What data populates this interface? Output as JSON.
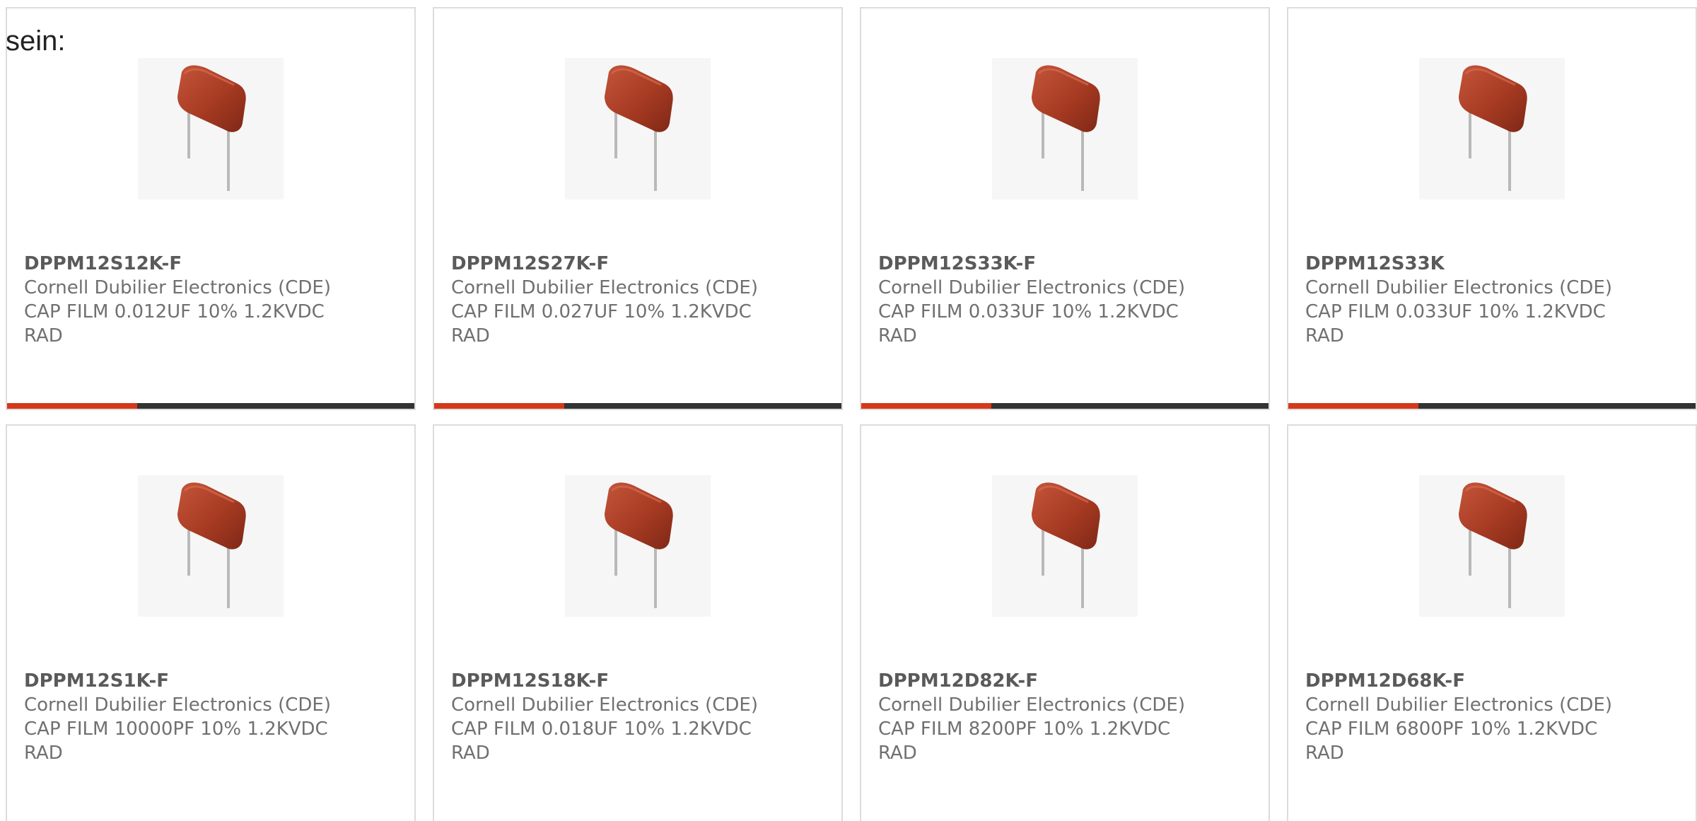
{
  "intro_text": "sein:",
  "accent_color": "#d6381a",
  "bar_color": "#333333",
  "products": [
    {
      "part_number": "DPPM12S12K-F",
      "manufacturer": "Cornell Dubilier Electronics (CDE)",
      "description_line1": "CAP FILM 0.012UF 10% 1.2KVDC",
      "description_line2": "RAD",
      "image_icon": "film-capacitor-icon",
      "accent_fraction": 0.32
    },
    {
      "part_number": "DPPM12S27K-F",
      "manufacturer": "Cornell Dubilier Electronics (CDE)",
      "description_line1": "CAP FILM 0.027UF 10% 1.2KVDC",
      "description_line2": "RAD",
      "image_icon": "film-capacitor-icon",
      "accent_fraction": 0.32
    },
    {
      "part_number": "DPPM12S33K-F",
      "manufacturer": "Cornell Dubilier Electronics (CDE)",
      "description_line1": "CAP FILM 0.033UF 10% 1.2KVDC",
      "description_line2": "RAD",
      "image_icon": "film-capacitor-icon",
      "accent_fraction": 0.32
    },
    {
      "part_number": "DPPM12S33K",
      "manufacturer": "Cornell Dubilier Electronics (CDE)",
      "description_line1": "CAP FILM 0.033UF 10% 1.2KVDC",
      "description_line2": "RAD",
      "image_icon": "film-capacitor-icon",
      "accent_fraction": 0.32
    },
    {
      "part_number": "DPPM12S1K-F",
      "manufacturer": "Cornell Dubilier Electronics (CDE)",
      "description_line1": "CAP FILM 10000PF 10% 1.2KVDC",
      "description_line2": "RAD",
      "image_icon": "film-capacitor-icon"
    },
    {
      "part_number": "DPPM12S18K-F",
      "manufacturer": "Cornell Dubilier Electronics (CDE)",
      "description_line1": "CAP FILM 0.018UF 10% 1.2KVDC",
      "description_line2": "RAD",
      "image_icon": "film-capacitor-icon"
    },
    {
      "part_number": "DPPM12D82K-F",
      "manufacturer": "Cornell Dubilier Electronics (CDE)",
      "description_line1": "CAP FILM 8200PF 10% 1.2KVDC",
      "description_line2": "RAD",
      "image_icon": "film-capacitor-icon"
    },
    {
      "part_number": "DPPM12D68K-F",
      "manufacturer": "Cornell Dubilier Electronics (CDE)",
      "description_line1": "CAP FILM 6800PF 10% 1.2KVDC",
      "description_line2": "RAD",
      "image_icon": "film-capacitor-icon"
    }
  ]
}
